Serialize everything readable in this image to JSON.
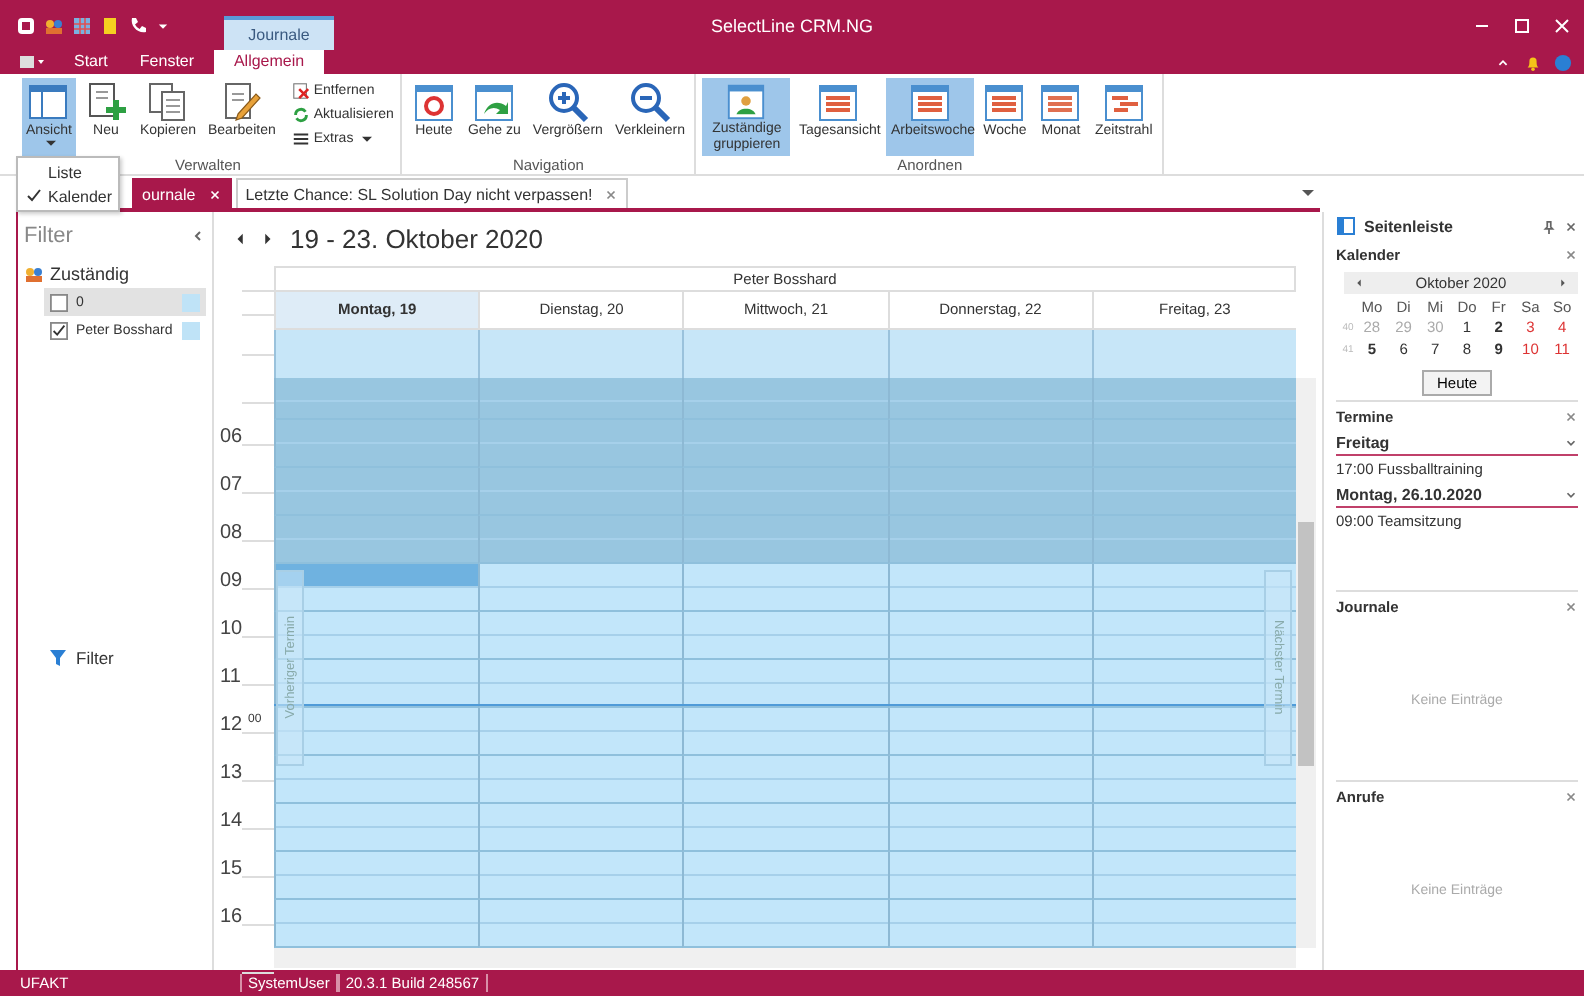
{
  "window": {
    "title": "SelectLine CRM.NG",
    "contextual_tab": "Journale"
  },
  "ribbon_tabs": [
    {
      "label": "Start",
      "selected": false
    },
    {
      "label": "Fenster",
      "selected": false
    },
    {
      "label": "Allgemein",
      "selected": true
    }
  ],
  "ribbon_groups": [
    {
      "label": "Verwalten",
      "buttons": [
        {
          "label": "Ansicht",
          "kind": "view",
          "selected": true,
          "dropdown": true
        },
        {
          "label": "Neu",
          "kind": "new",
          "selected": false,
          "dropdown": false
        },
        {
          "label": "Kopieren",
          "kind": "copy",
          "selected": false,
          "dropdown": false
        },
        {
          "label": "Bearbeiten",
          "kind": "edit",
          "selected": false,
          "dropdown": false
        }
      ],
      "small_buttons": [
        {
          "label": "Entfernen",
          "kind": "remove",
          "dropdown": false
        },
        {
          "label": "Aktualisieren",
          "kind": "refresh",
          "dropdown": false
        },
        {
          "label": "Extras",
          "kind": "extras",
          "dropdown": true
        }
      ]
    },
    {
      "label": "Navigation",
      "buttons": [
        {
          "label": "Heute",
          "kind": "today",
          "selected": false,
          "dropdown": false
        },
        {
          "label": "Gehe zu",
          "kind": "goto",
          "selected": false,
          "dropdown": false
        },
        {
          "label": "Vergrößern",
          "kind": "zoomin",
          "selected": false,
          "dropdown": false
        },
        {
          "label": "Verkleinern",
          "kind": "zoomout",
          "selected": false,
          "dropdown": false
        }
      ]
    },
    {
      "label": "Anordnen",
      "buttons": [
        {
          "label": "Zuständige gruppieren",
          "kind": "group",
          "selected": true,
          "dropdown": false
        },
        {
          "label": "Tagesansicht",
          "kind": "day",
          "selected": false,
          "dropdown": false
        },
        {
          "label": "Arbeitswoche",
          "kind": "workweek",
          "selected": true,
          "dropdown": false
        },
        {
          "label": "Woche",
          "kind": "week",
          "selected": false,
          "dropdown": false
        },
        {
          "label": "Monat",
          "kind": "month",
          "selected": false,
          "dropdown": false
        },
        {
          "label": "Zeitstrahl",
          "kind": "timeline",
          "selected": false,
          "dropdown": false
        }
      ]
    }
  ],
  "view_menu": {
    "items": [
      {
        "label": "Liste",
        "checked": false
      },
      {
        "label": "Kalender",
        "checked": true
      }
    ]
  },
  "doc_tabs": [
    {
      "label": "ournale",
      "selected": true
    },
    {
      "label": "Letzte Chance: SL Solution Day nicht verpassen!",
      "selected": false
    }
  ],
  "filter": {
    "title": "Filter",
    "group": {
      "label": "Zuständig",
      "items": [
        {
          "label": "0",
          "checked": false,
          "selected": true,
          "color": "#bfe3f7"
        },
        {
          "label": "Peter Bosshard",
          "checked": true,
          "selected": false,
          "color": "#bfe3f7"
        }
      ]
    },
    "footer": "Filter"
  },
  "calendar": {
    "range": "19 - 23. Oktober 2020",
    "resource": "Peter Bosshard",
    "days": [
      {
        "label": "Montag, 19",
        "selected": true
      },
      {
        "label": "Dienstag, 20",
        "selected": false
      },
      {
        "label": "Mittwoch, 21",
        "selected": false
      },
      {
        "label": "Donnerstag, 22",
        "selected": false
      },
      {
        "label": "Freitag, 23",
        "selected": false
      }
    ],
    "hours": [
      {
        "label": "06",
        "working": false,
        "selected": false
      },
      {
        "label": "07",
        "working": false,
        "selected": false
      },
      {
        "label": "08",
        "working": false,
        "selected": false
      },
      {
        "label": "09",
        "working": true,
        "selected": true
      },
      {
        "label": "10",
        "working": true,
        "selected": false
      },
      {
        "label": "11",
        "working": true,
        "selected": false
      },
      {
        "label": "12",
        "minutes": "00",
        "working": true,
        "selected": false
      },
      {
        "label": "13",
        "working": true,
        "selected": false
      },
      {
        "label": "14",
        "working": true,
        "selected": false
      },
      {
        "label": "15",
        "working": true,
        "selected": false
      },
      {
        "label": "16",
        "working": true,
        "selected": false
      }
    ],
    "prev_label": "Vorheriger Termin",
    "next_label": "Nächster Termin"
  },
  "sidebar": {
    "title": "Seitenleiste",
    "calendar": {
      "title": "Kalender",
      "month": "Oktober 2020",
      "weekdays": [
        "Mo",
        "Di",
        "Mi",
        "Do",
        "Fr",
        "Sa",
        "So"
      ],
      "weeks": [
        {
          "number": "40",
          "days": [
            {
              "label": "28",
              "other_month": true,
              "bold": false
            },
            {
              "label": "29",
              "other_month": true,
              "bold": false
            },
            {
              "label": "30",
              "other_month": true,
              "bold": false
            },
            {
              "label": "1",
              "other_month": false,
              "bold": false
            },
            {
              "label": "2",
              "other_month": false,
              "bold": true
            },
            {
              "label": "3",
              "other_month": false,
              "bold": false
            },
            {
              "label": "4",
              "other_month": false,
              "bold": false
            }
          ]
        },
        {
          "number": "41",
          "days": [
            {
              "label": "5",
              "other_month": false,
              "bold": true
            },
            {
              "label": "6",
              "other_month": false,
              "bold": false
            },
            {
              "label": "7",
              "other_month": false,
              "bold": false
            },
            {
              "label": "8",
              "other_month": false,
              "bold": false
            },
            {
              "label": "9",
              "other_month": false,
              "bold": true
            },
            {
              "label": "10",
              "other_month": false,
              "bold": false
            },
            {
              "label": "11",
              "other_month": false,
              "bold": false
            }
          ]
        }
      ],
      "today_button": "Heute"
    },
    "appointments": {
      "title": "Termine",
      "groups": [
        {
          "label": "Freitag",
          "items": [
            "17:00 Fussballtraining"
          ]
        },
        {
          "label": "Montag, 26.10.2020",
          "items": [
            "09:00 Teamsitzung"
          ]
        }
      ]
    },
    "journals": {
      "title": "Journale",
      "empty": "Keine Einträge"
    },
    "calls": {
      "title": "Anrufe",
      "empty": "Keine Einträge"
    }
  },
  "status_bar": {
    "app": "UFAKT",
    "user": "SystemUser",
    "version": "20.3.1 Build 248567"
  }
}
